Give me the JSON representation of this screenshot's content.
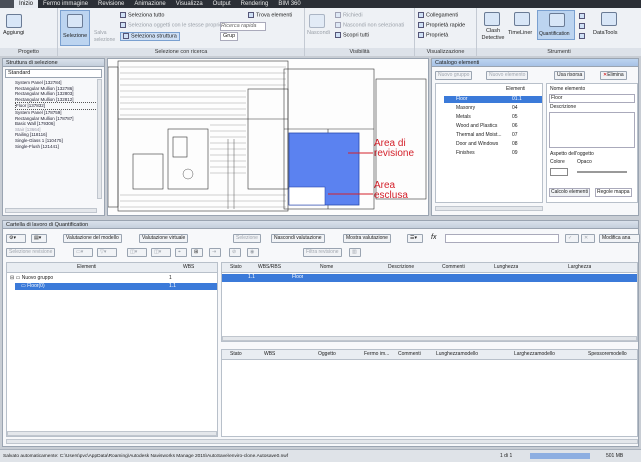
{
  "menubar": {
    "tabs": [
      "Inizio",
      "Fermo immagine",
      "Revisione",
      "Animazione",
      "Visualizza",
      "Output",
      "Rendering",
      "BIM 360"
    ]
  },
  "ribbon": {
    "aggiungi": "Aggiungi",
    "progetto": "Progetto",
    "selezione_label": "Selezione",
    "salva_selezione": "Salva selezione",
    "seleziona_tutto": "Seleziona tutto",
    "seleziona_oggetti": "Seleziona oggetti con le stesse proprietà",
    "seleziona_struttura": "Seleziona struttura",
    "trova_elementi": "Trova elementi",
    "ricerca_rapida": "Ricerca rapida",
    "grup": "Grup",
    "selezione_ricerca": "Selezione con ricerca",
    "nascondi": "Nascondi",
    "richiedi": "Richiedi",
    "nascondi_non_sel": "Nascondi non selezionati",
    "scopri_tutti": "Scopri tutti",
    "visibilita": "Visibilità",
    "collegamenti": "Collegamenti",
    "proprieta_rapide": "Proprietà rapide",
    "proprieta": "Proprietà",
    "visualizzazione": "Visualizzazione",
    "clash": "Clash Detective",
    "timeliner": "TimeLiner",
    "quantification": "Quantification",
    "datatools": "DataTools",
    "strumenti": "Strumenti"
  },
  "selection_tree": {
    "title": "Struttura di selezione",
    "mode": "Standard",
    "items": [
      "System Panel [132784]",
      "Rectangular Mullion [132786]",
      "Rectangular Mullion [132803]",
      "Rectangular Mullion [132812]",
      "Floor [137832]",
      "System Panel [178759]",
      "Rectangular Mullion [178787]",
      "Basic Wall [179306]",
      "Stair [13664]",
      "Railing [118116]",
      "Single-Glass 1 [110475]",
      "Single-Flush [121441]"
    ]
  },
  "viewport": {
    "annot1": "Area di\nrevisione",
    "annot2": "Area\nesclusa"
  },
  "catalog": {
    "title": "Catalogo elementi",
    "btn_new_group": "Nuovo gruppo",
    "btn_new_element": "Nuovo elemento",
    "btn_use_resource": "Usa risorsa",
    "btn_delete": "Elimina",
    "col_elements": "Elementi",
    "items": [
      {
        "name": "Floor",
        "code": "01.1"
      },
      {
        "name": "Masonry",
        "code": "04"
      },
      {
        "name": "Metals",
        "code": "05"
      },
      {
        "name": "Wood and Plastics",
        "code": "06"
      },
      {
        "name": "Thermal and Moist...",
        "code": "07"
      },
      {
        "name": "Door and Windows",
        "code": "08"
      },
      {
        "name": "Finishes",
        "code": "09"
      }
    ],
    "label_name": "Nome elemento",
    "value_name": "Floor",
    "label_desc": "Descrizione",
    "label_aspect": "Aspetto dell'oggetto",
    "label_color": "Colore",
    "label_opacity": "Opaco",
    "tab_calc": "Calcolo elementi",
    "tab_rules": "Regole mappa"
  },
  "workbook": {
    "title": "Cartella di lavoro di Quantification",
    "btn_model_val": "Valutazione del modello",
    "btn_virtual_val": "Valutazione virtuale",
    "btn_selection": "Selezione",
    "btn_hide_val": "Nascondi valutazione",
    "btn_show_val": "Mostra valutazione",
    "btn_selection_rev": "Selezione revisione",
    "btn_filter": "Filtra revisione",
    "btn_modify": "Modifica ana",
    "fx": "fx",
    "left_cols": [
      "Elementi",
      "WBS"
    ],
    "groups": [
      {
        "name": "Nuovo gruppo",
        "wbs": "1"
      },
      {
        "name": "Floor(0)",
        "wbs": "1.1"
      }
    ],
    "top_cols": [
      "Stato",
      "WBS/RBS",
      "Nome",
      "Descrizione",
      "Commenti",
      "Lunghezza",
      "Larghezza"
    ],
    "top_row": [
      "",
      "1.1",
      "Floor",
      "",
      "",
      "",
      ""
    ],
    "bottom_cols": [
      "Stato",
      "WBS",
      "Oggetto",
      "Fermo im...",
      "Commenti",
      "Lunghezzamodello",
      "Larghezzamodello",
      "Spessoremodello"
    ]
  },
  "status": {
    "text": "Salvato automaticamente: C:\\Users\\pvc\\AppData\\Roaming\\Autodesk Navisworks Manage 2015\\AutoSave\\enviro-clone.Autosave0.nwf",
    "page": "1 di 1",
    "mem": "501 MB"
  },
  "colors": {
    "accent": "#3b7ad9",
    "annot": "#d4212b",
    "area": "#5b82f0"
  }
}
